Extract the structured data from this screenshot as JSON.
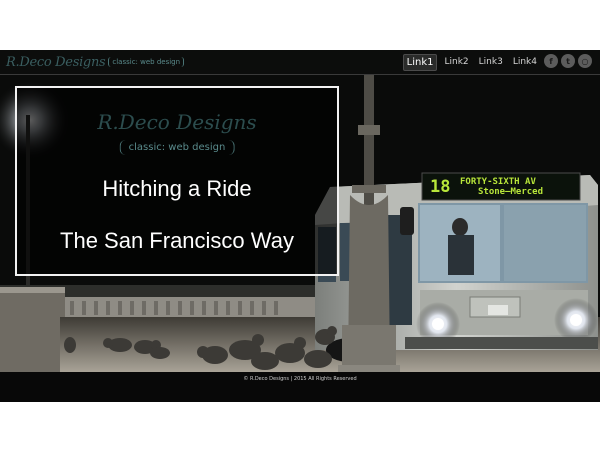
{
  "header": {
    "logo_script": "R.Deco Designs",
    "logo_tag": "classic: web design",
    "nav": [
      "Link1",
      "Link2",
      "Link3",
      "Link4"
    ],
    "active_link": "Link1",
    "social_icons": [
      "facebook-icon",
      "twitter-icon",
      "instagram-icon"
    ]
  },
  "hero": {
    "logo_script": "R.Deco Designs",
    "logo_tag": "classic: web design",
    "headline_line1": "Hitching a Ride",
    "headline_line2": "The San Francisco Way",
    "bus_sign_number": "18",
    "bus_sign_line1": "FORTY-SIXTH AV",
    "bus_sign_line2": "Stone—Merced"
  },
  "footer": {
    "copyright": "© R.Deco Designs  |  2015 All Rights Reserved"
  },
  "colors": {
    "header_bg": "#0c0d0c",
    "logo_teal": "#3a5e60",
    "overlay_border": "#f2f2f2",
    "bus_sign_green": "#b8e63a"
  }
}
